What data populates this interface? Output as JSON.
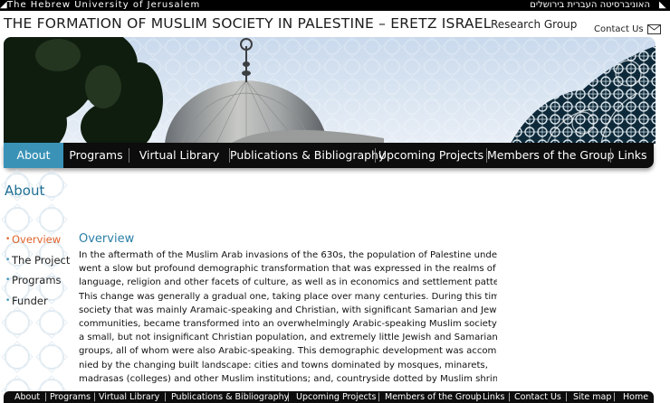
{
  "topbar": {
    "university_en": "The Hebrew University of Jerusalem",
    "university_he": "האוניברסיטה העברית בירושלים"
  },
  "header": {
    "site_title": "THE FORMATION OF MUSLIM SOCIETY IN PALESTINE – ERETZ ISRAEL",
    "research_group": "Research Group",
    "contact_label": "Contact Us"
  },
  "main_nav": [
    {
      "label": "About",
      "active": true
    },
    {
      "label": "Programs"
    },
    {
      "label": "Virtual Library"
    },
    {
      "label": "Publications & Bibliography"
    },
    {
      "label": "Upcoming Projects"
    },
    {
      "label": "Members of the Group"
    },
    {
      "label": "Links"
    }
  ],
  "page": {
    "heading": "About"
  },
  "sidenav": [
    {
      "label": "Overview",
      "current": true
    },
    {
      "label": "The Project"
    },
    {
      "label": "Programs"
    },
    {
      "label": "Funder"
    }
  ],
  "content": {
    "section_title": "Overview",
    "lines": [
      "In the aftermath of the Muslim Arab invasions of the 630s, the population of Palestine under-",
      "went a slow but profound demographic transformation that was expressed in the realms of",
      "language, religion and other facets of culture, as well as in economics and settlement patterns.",
      "This change was generally a gradual one, taking place over many centuries. During this time, a",
      "society that was mainly Aramaic-speaking and Christian, with significant Samarian and Jewish",
      "communities, became transformed into an overwhelmingly Arabic-speaking Muslim society, with",
      "a small, but not insignificant Christian population, and extremely little Jewish and Samarian",
      "groups, all of whom were also Arabic-speaking. This demographic development was accompa-",
      "nied by the changing built landscape: cities and towns dominated by mosques, minarets,",
      "madrasas (colleges) and other Muslim institutions; and, countryside dotted by Muslim shrines"
    ]
  },
  "footer_nav": [
    {
      "label": "About"
    },
    {
      "label": "Programs"
    },
    {
      "label": "Virtual Library"
    },
    {
      "label": "Publications & Bibliography"
    },
    {
      "label": "Upcoming Projects"
    },
    {
      "label": "Members of the Group"
    },
    {
      "label": "Links"
    },
    {
      "label": "Contact Us"
    },
    {
      "label": "Site map"
    },
    {
      "label": "Home"
    }
  ],
  "colors": {
    "accent": "#3a93b7",
    "current": "#e0622a",
    "bar": "#0d0d0d"
  }
}
